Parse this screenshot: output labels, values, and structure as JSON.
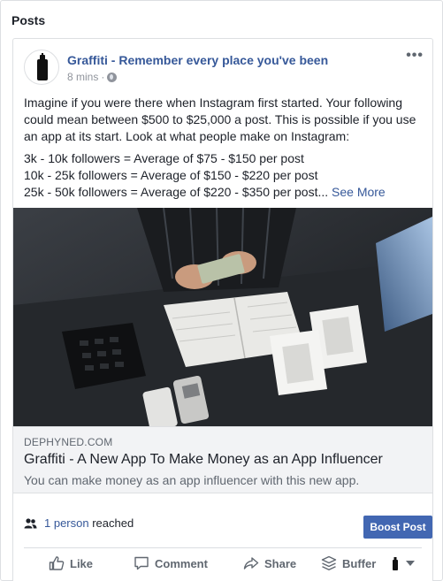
{
  "section": {
    "title": "Posts"
  },
  "post": {
    "page_name": "Graffiti - Remember every place you've been",
    "time": "8 mins",
    "separator": "·",
    "privacy_icon": "globe-icon",
    "more_icon": "more-options-icon",
    "paragraph": "Imagine if you were there when Instagram first started. Your following could mean between $500 to $25,000 a post. This is possible if you use an app at its start. Look at what people make on Instagram:",
    "lines": [
      "3k - 10k followers = Average of $75 - $150 per post",
      "10k - 25k followers = Average of $150 - $220 per post",
      "25k - 50k followers = Average of $220 - $350 per post..."
    ],
    "see_more": "See More"
  },
  "link_preview": {
    "domain": "DEPHYNED.COM",
    "title": "Graffiti - A New App To Make Money as an App Influencer",
    "description": "You can make money as an app influencer with this new app."
  },
  "stats": {
    "reach_count": "1 person",
    "reach_suffix": "reached",
    "boost_label": "Boost Post"
  },
  "actions": {
    "like": "Like",
    "comment": "Comment",
    "share": "Share",
    "buffer": "Buffer"
  },
  "colors": {
    "link": "#365899",
    "boost": "#4267b2",
    "link_box_bg": "#f2f3f5"
  }
}
